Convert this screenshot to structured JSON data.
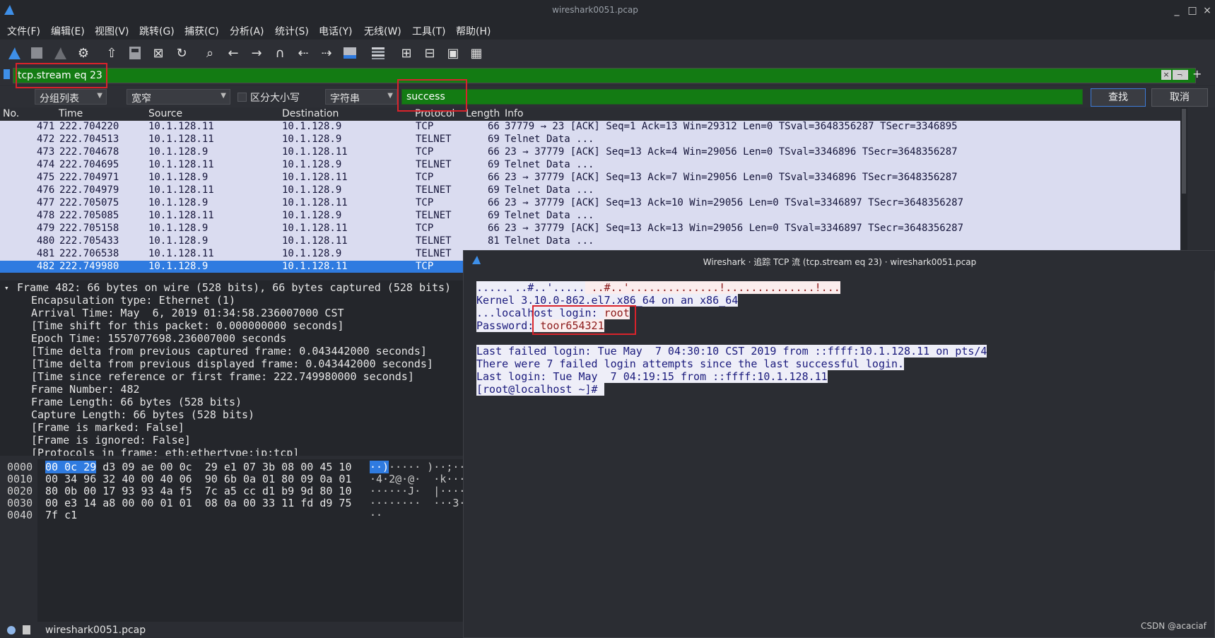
{
  "window": {
    "title": "wireshark0051.pcap",
    "minimize": "_",
    "maximize": "□",
    "close": "×"
  },
  "menu": [
    "文件(F)",
    "编辑(E)",
    "视图(V)",
    "跳转(G)",
    "捕获(C)",
    "分析(A)",
    "统计(S)",
    "电话(Y)",
    "无线(W)",
    "工具(T)",
    "帮助(H)"
  ],
  "filter": {
    "value": "tcp.stream eq 23",
    "plus": "+"
  },
  "find": {
    "search_in": "分组列表",
    "charset": "宽窄",
    "case_label": "区分大小写",
    "type": "字符串",
    "value": "success",
    "find_button": "查找",
    "cancel_button": "取消"
  },
  "packet_list": {
    "columns": [
      "No.",
      "Time",
      "Source",
      "Destination",
      "Protocol",
      "Length",
      "Info"
    ],
    "rows": [
      {
        "no": "471",
        "time": "222.704220",
        "src": "10.1.128.11",
        "dst": "10.1.128.9",
        "proto": "TCP",
        "len": "66",
        "info": "37779 → 23 [ACK] Seq=1 Ack=13 Win=29312 Len=0 TSval=3648356287 TSecr=3346895"
      },
      {
        "no": "472",
        "time": "222.704513",
        "src": "10.1.128.11",
        "dst": "10.1.128.9",
        "proto": "TELNET",
        "len": "69",
        "info": "Telnet Data ..."
      },
      {
        "no": "473",
        "time": "222.704678",
        "src": "10.1.128.9",
        "dst": "10.1.128.11",
        "proto": "TCP",
        "len": "66",
        "info": "23 → 37779 [ACK] Seq=13 Ack=4 Win=29056 Len=0 TSval=3346896 TSecr=3648356287"
      },
      {
        "no": "474",
        "time": "222.704695",
        "src": "10.1.128.11",
        "dst": "10.1.128.9",
        "proto": "TELNET",
        "len": "69",
        "info": "Telnet Data ..."
      },
      {
        "no": "475",
        "time": "222.704971",
        "src": "10.1.128.9",
        "dst": "10.1.128.11",
        "proto": "TCP",
        "len": "66",
        "info": "23 → 37779 [ACK] Seq=13 Ack=7 Win=29056 Len=0 TSval=3346896 TSecr=3648356287"
      },
      {
        "no": "476",
        "time": "222.704979",
        "src": "10.1.128.11",
        "dst": "10.1.128.9",
        "proto": "TELNET",
        "len": "69",
        "info": "Telnet Data ..."
      },
      {
        "no": "477",
        "time": "222.705075",
        "src": "10.1.128.9",
        "dst": "10.1.128.11",
        "proto": "TCP",
        "len": "66",
        "info": "23 → 37779 [ACK] Seq=13 Ack=10 Win=29056 Len=0 TSval=3346897 TSecr=3648356287"
      },
      {
        "no": "478",
        "time": "222.705085",
        "src": "10.1.128.11",
        "dst": "10.1.128.9",
        "proto": "TELNET",
        "len": "69",
        "info": "Telnet Data ..."
      },
      {
        "no": "479",
        "time": "222.705158",
        "src": "10.1.128.9",
        "dst": "10.1.128.11",
        "proto": "TCP",
        "len": "66",
        "info": "23 → 37779 [ACK] Seq=13 Ack=13 Win=29056 Len=0 TSval=3346897 TSecr=3648356287"
      },
      {
        "no": "480",
        "time": "222.705433",
        "src": "10.1.128.9",
        "dst": "10.1.128.11",
        "proto": "TELNET",
        "len": "81",
        "info": "Telnet Data ..."
      },
      {
        "no": "481",
        "time": "222.706538",
        "src": "10.1.128.11",
        "dst": "10.1.128.9",
        "proto": "TELNET",
        "len": "",
        "info": ""
      },
      {
        "no": "482",
        "time": "222.749980",
        "src": "10.1.128.9",
        "dst": "10.1.128.11",
        "proto": "TCP",
        "len": "",
        "info": ""
      }
    ]
  },
  "details": {
    "frame": "Frame 482: 66 bytes on wire (528 bits), 66 bytes captured (528 bits)",
    "lines": [
      "Encapsulation type: Ethernet (1)",
      "Arrival Time: May  6, 2019 01:34:58.236007000 CST",
      "[Time shift for this packet: 0.000000000 seconds]",
      "Epoch Time: 1557077698.236007000 seconds",
      "[Time delta from previous captured frame: 0.043442000 seconds]",
      "[Time delta from previous displayed frame: 0.043442000 seconds]",
      "[Time since reference or first frame: 222.749980000 seconds]",
      "Frame Number: 482",
      "Frame Length: 66 bytes (528 bits)",
      "Capture Length: 66 bytes (528 bits)",
      "[Frame is marked: False]",
      "[Frame is ignored: False]",
      "[Protocols in frame: eth:ethertype:ip:tcp]"
    ]
  },
  "bytes": {
    "offsets": [
      "0000",
      "0010",
      "0020",
      "0030",
      "0040"
    ],
    "hex_first_sel": "00 0c 29",
    "hex_first_rest": " d3 09 ae 00 0c  29 e1 07 3b 08 00 45 10",
    "hex": [
      "00 34 96 32 40 00 40 06  90 6b 0a 01 80 09 0a 01",
      "80 0b 00 17 93 93 4a f5  7c a5 cc d1 b9 9d 80 10",
      "00 e3 14 a8 00 00 01 01  08 0a 00 33 11 fd d9 75",
      "7f c1"
    ],
    "ascii_first_sel": "··)",
    "ascii_first_rest": "····· )··;··",
    "ascii": [
      "·4·2@·@·  ·k····",
      "······J·  |·······",
      "········  ···3··",
      "··"
    ]
  },
  "status": {
    "file": "wireshark0051.pcap"
  },
  "follow_dialog": {
    "title": "Wireshark · 追踪 TCP 流 (tcp.stream eq 23) · wireshark0051.pcap",
    "lines": [
      {
        "text": "..... ..#..'.....",
        "side": "srv"
      },
      {
        "text": " ..#..'..............!..............!...",
        "side": "cli"
      },
      {
        "text": "Kernel 3.10.0-862.el7.x86_64 on an x86_64",
        "side": "srv"
      },
      {
        "text": "...localhost login: ",
        "side": "srv"
      },
      {
        "text": "root",
        "side": "cli"
      },
      {
        "text": "Password: ",
        "side": "srv"
      },
      {
        "text": "toor654321",
        "side": "cli"
      },
      {
        "text": "Last failed login: Tue May  7 04:30:10 CST 2019 from ::ffff:10.1.128.11 on pts/4",
        "side": "srv"
      },
      {
        "text": "There were 7 failed login attempts since the last successful login.",
        "side": "srv"
      },
      {
        "text": "Last login: Tue May  7 04:19:15 from ::ffff:10.1.128.11",
        "side": "srv"
      },
      {
        "text": "[root@localhost ~]# ",
        "side": "srv"
      }
    ]
  },
  "watermark": "CSDN @acaciaf",
  "colors": {
    "filter_valid": "#137b13",
    "selection": "#2f7be0",
    "highlight_box": "#d9232b",
    "client_text": "#8c1a1a",
    "server_text": "#1a1a7c"
  }
}
